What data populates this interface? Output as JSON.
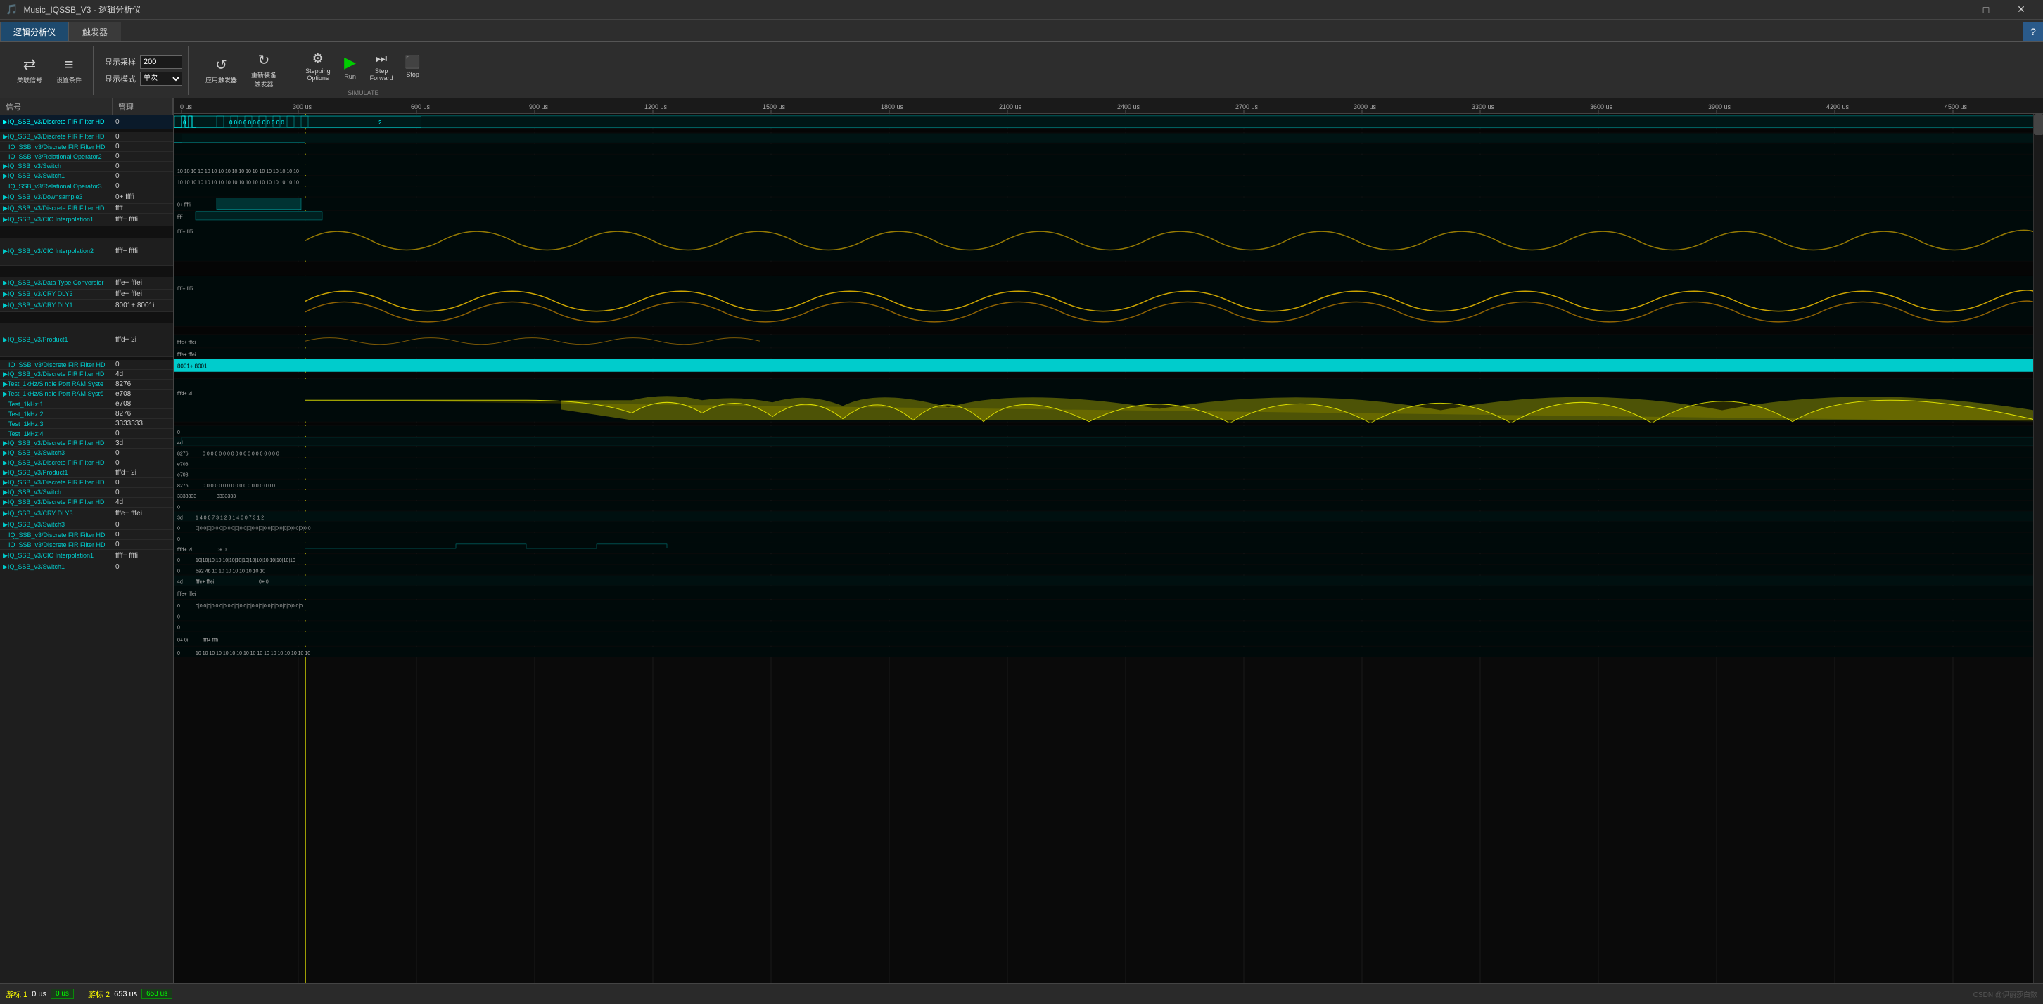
{
  "titleBar": {
    "title": "Music_IQSSB_V3 - 逻辑分析仪",
    "controls": [
      "—",
      "□",
      "✕"
    ]
  },
  "tabs": [
    {
      "id": "logic",
      "label": "逻辑分析仪",
      "active": true
    },
    {
      "id": "trigger",
      "label": "触发器",
      "active": false
    }
  ],
  "toolbar": {
    "groups": [
      {
        "id": "signal-group",
        "items": [
          {
            "id": "link-signal",
            "icon": "⇄",
            "label": "关联信号"
          },
          {
            "id": "set-trigger",
            "icon": "≡",
            "label": "设置条件"
          }
        ]
      },
      {
        "id": "display-group",
        "label1": "显示采样",
        "value1": "200",
        "label2": "显示模式",
        "value2": "单次"
      },
      {
        "id": "trigger-group",
        "items": [
          {
            "id": "apply-trigger",
            "icon": "↺",
            "label": "应用触发器"
          },
          {
            "id": "reset-trigger",
            "icon": "↻",
            "label": "重新装备触发器"
          }
        ]
      },
      {
        "id": "simulate-group",
        "label": "SIMULATE",
        "items": [
          {
            "id": "stepping-options",
            "icon": "⚙",
            "label": "Stepping\nOptions"
          },
          {
            "id": "run",
            "icon": "▶",
            "label": "Run",
            "active": true
          },
          {
            "id": "step-forward",
            "icon": "⏭",
            "label": "Step\nForward"
          },
          {
            "id": "stop",
            "icon": "⬛",
            "label": "Stop"
          }
        ]
      }
    ]
  },
  "signalPanel": {
    "headers": [
      "信号",
      "管理"
    ],
    "signals": [
      {
        "name": "▶IQ_SSB_v3/Discrete FIR Filter HD",
        "value": "0",
        "indent": 0,
        "type": "bus",
        "color": "cyan"
      },
      {
        "name": "",
        "value": "",
        "indent": 0,
        "type": "spacer"
      },
      {
        "name": "▶IQ_SSB_v3/Discrete FIR Filter HD",
        "value": "0",
        "indent": 0,
        "type": "bus"
      },
      {
        "name": "  IQ_SSB_v3/Discrete FIR Filter HD",
        "value": "0",
        "indent": 1
      },
      {
        "name": "  IQ_SSB_v3/Relational Operator2",
        "value": "0",
        "indent": 1
      },
      {
        "name": "▶IQ_SSB_v3/Switch",
        "value": "0",
        "indent": 0
      },
      {
        "name": "▶IQ_SSB_v3/Switch1",
        "value": "0",
        "indent": 0
      },
      {
        "name": "  IQ_SSB_v3/Relational Operator3",
        "value": "0",
        "indent": 1
      },
      {
        "name": "▶IQ_SSB_v3/Downsample3",
        "value": "0+ ffffi",
        "indent": 0
      },
      {
        "name": "▶IQ_SSB_v3/Discrete FIR Filter HD",
        "value": "ffff",
        "indent": 0
      },
      {
        "name": "▶IQ_SSB_v3/CIC Interpolation1",
        "value": "ffff+ ffffi",
        "indent": 0
      },
      {
        "name": "",
        "value": "",
        "indent": 0,
        "type": "spacer"
      },
      {
        "name": "▶IQ_SSB_v3/CIC Interpolation2",
        "value": "ffff+ ffffi",
        "indent": 0
      },
      {
        "name": "",
        "value": "",
        "indent": 0,
        "type": "spacer"
      },
      {
        "name": "▶IQ_SSB_v3/Data Type Conversior",
        "value": "fffe+ fffei",
        "indent": 0
      },
      {
        "name": "▶IQ_SSB_v3/CRY DLY3",
        "value": "fffe+ fffei",
        "indent": 0
      },
      {
        "name": "▶IQ_SSB_v3/CRY DLY1",
        "value": "8001+ 8001i",
        "indent": 0
      },
      {
        "name": "",
        "value": "",
        "indent": 0,
        "type": "spacer"
      },
      {
        "name": "▶IQ_SSB_v3/Product1",
        "value": "fffd+ 2i",
        "indent": 0
      },
      {
        "name": "",
        "value": "",
        "indent": 0,
        "type": "spacer"
      },
      {
        "name": "  IQ_SSB_v3/Discrete FIR Filter HD",
        "value": "0",
        "indent": 1
      },
      {
        "name": "▶IQ_SSB_v3/Discrete FIR Filter HD",
        "value": "4d",
        "indent": 0
      },
      {
        "name": "▶Test_1kHz/Single Port RAM Syste",
        "value": "8276",
        "indent": 0
      },
      {
        "name": "▶Test_1kHz/Single Port RAM Syst€",
        "value": "e708",
        "indent": 0
      },
      {
        "name": "  Test_1kHz:1",
        "value": "e708",
        "indent": 1
      },
      {
        "name": "  Test_1kHz:2",
        "value": "8276",
        "indent": 1
      },
      {
        "name": "  Test_1kHz:3",
        "value": "3333333",
        "indent": 1
      },
      {
        "name": "  Test_1kHz:4",
        "value": "0",
        "indent": 1
      },
      {
        "name": "▶IQ_SSB_v3/Discrete FIR Filter HD",
        "value": "3d",
        "indent": 0
      },
      {
        "name": "▶IQ_SSB_v3/Switch3",
        "value": "0",
        "indent": 0
      },
      {
        "name": "▶IQ_SSB_v3/Discrete FIR Filter HD",
        "value": "0",
        "indent": 0
      },
      {
        "name": "▶IQ_SSB_v3/Product1",
        "value": "fffd+ 2i",
        "indent": 0
      },
      {
        "name": "▶IQ_SSB_v3/Discrete FIR Filter HD",
        "value": "0",
        "indent": 0
      },
      {
        "name": "▶IQ_SSB_v3/Switch",
        "value": "0",
        "indent": 0
      },
      {
        "name": "▶IQ_SSB_v3/Discrete FIR Filter HD",
        "value": "4d",
        "indent": 0
      },
      {
        "name": "▶IQ_SSB_v3/CRY DLY3",
        "value": "fffe+ fffei",
        "indent": 0
      },
      {
        "name": "▶IQ_SSB_v3/Switch3",
        "value": "0",
        "indent": 0
      },
      {
        "name": "  IQ_SSB_v3/Discrete FIR Filter HD",
        "value": "0",
        "indent": 1
      },
      {
        "name": "  IQ_SSB_v3/Discrete FIR Filter HD",
        "value": "0",
        "indent": 1
      },
      {
        "name": "▶IQ_SSB_v3/CIC Interpolation1",
        "value": "ffff+ ffffi",
        "indent": 0
      },
      {
        "name": "▶IQ_SSB_v3/Switch1",
        "value": "0",
        "indent": 0
      }
    ]
  },
  "timeline": {
    "ticks": [
      "0 us",
      "300 us",
      "600 us",
      "900 us",
      "1200 us",
      "1500 us",
      "1800 us",
      "2100 us",
      "2400 us",
      "2700 us",
      "3000 us",
      "3300 us",
      "3600 us",
      "3900 us",
      "4200 us",
      "4500 us"
    ]
  },
  "statusBar": {
    "marker1_label": "游标 1",
    "marker1_value": "0 us",
    "marker1_box": "0 us",
    "marker2_label": "游标 2",
    "marker2_value": "653 us",
    "marker2_box": "653 us",
    "cursor_pos": "653 us",
    "watermark": "CSDN @伊丽莎白数"
  },
  "colors": {
    "cyan": "#00ffff",
    "yellow": "#ffff00",
    "green": "#00cc00",
    "waveformBg": "#0a0a0a",
    "panelBg": "#1e1e1e",
    "toolbarBg": "#2d2d2d",
    "tabActive": "#1e4a6e"
  }
}
